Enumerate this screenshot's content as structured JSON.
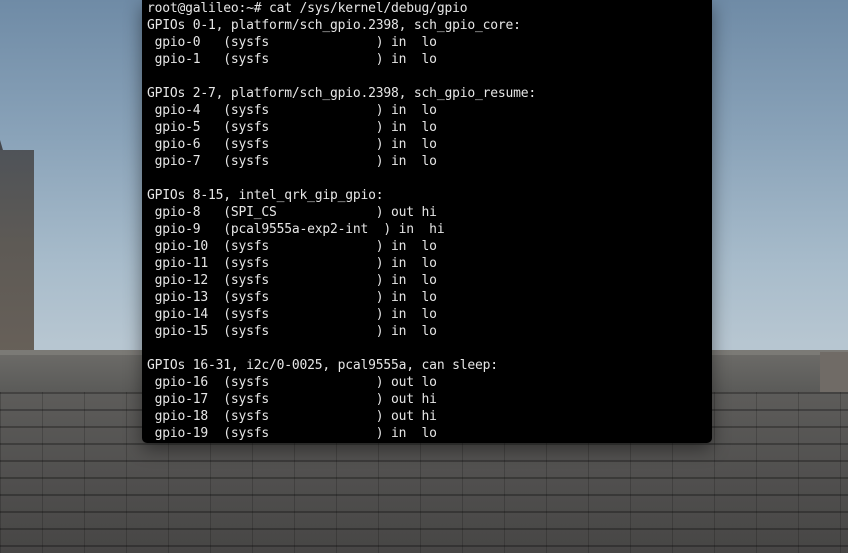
{
  "terminal": {
    "lines": [
      "root@galileo:~# cat /sys/kernel/debug/gpio",
      "GPIOs 0-1, platform/sch_gpio.2398, sch_gpio_core:",
      " gpio-0   (sysfs              ) in  lo",
      " gpio-1   (sysfs              ) in  lo",
      "",
      "GPIOs 2-7, platform/sch_gpio.2398, sch_gpio_resume:",
      " gpio-4   (sysfs              ) in  lo",
      " gpio-5   (sysfs              ) in  lo",
      " gpio-6   (sysfs              ) in  lo",
      " gpio-7   (sysfs              ) in  lo",
      "",
      "GPIOs 8-15, intel_qrk_gip_gpio:",
      " gpio-8   (SPI_CS             ) out hi",
      " gpio-9   (pcal9555a-exp2-int  ) in  hi",
      " gpio-10  (sysfs              ) in  lo",
      " gpio-11  (sysfs              ) in  lo",
      " gpio-12  (sysfs              ) in  lo",
      " gpio-13  (sysfs              ) in  lo",
      " gpio-14  (sysfs              ) in  lo",
      " gpio-15  (sysfs              ) in  lo",
      "",
      "GPIOs 16-31, i2c/0-0025, pcal9555a, can sleep:",
      " gpio-16  (sysfs              ) out lo",
      " gpio-17  (sysfs              ) out hi",
      " gpio-18  (sysfs              ) out hi",
      " gpio-19  (sysfs              ) in  lo"
    ]
  },
  "colors": {
    "terminal_bg": "#000000",
    "terminal_fg": "#e6e6e6"
  }
}
